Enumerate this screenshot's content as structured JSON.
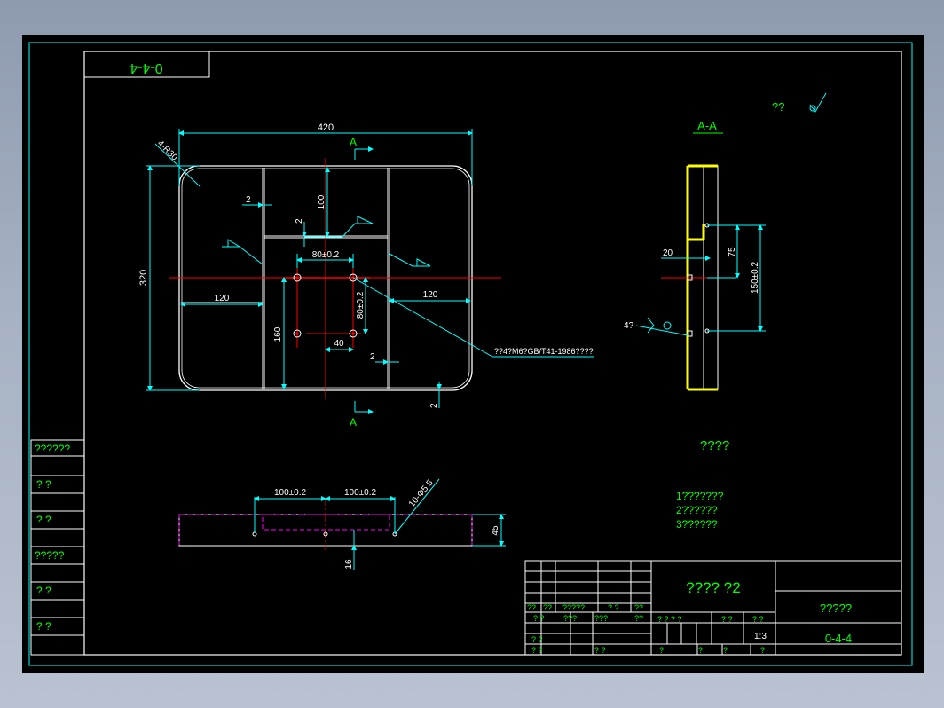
{
  "colors": {
    "frame": "#ffffff",
    "dimension": "#00ffff",
    "text": "#00ff00",
    "centerline": "#ff0000",
    "section": "#ffff00",
    "hidden": "#ff00ff"
  },
  "title_stamp": "0-4-4",
  "roughness_symbol": "??",
  "section_label_top": "A",
  "section_label_bottom": "A",
  "section_title": "A-A",
  "plan_view": {
    "dim_width": "420",
    "dim_height": "320",
    "corner_radius": "4-R30",
    "dim_100": "100",
    "dim_2_left": "2",
    "dim_2_mid": "2",
    "dim_80_h": "80±0.2",
    "dim_80_v": "80±0.2",
    "dim_120_left": "120",
    "dim_120_right": "120",
    "dim_160": "160",
    "dim_40": "40",
    "dim_2_bottom": "2",
    "dim_2_corner": "2",
    "hole_note": "??4?M6?GB/T41-1986????"
  },
  "section_view": {
    "dim_20": "20",
    "dim_75": "75",
    "dim_150": "150±0.2",
    "weld_label": "4?"
  },
  "front_view": {
    "dim_100_left": "100±0.2",
    "dim_100_right": "100±0.2",
    "hole_callout": "10-Φ5.5",
    "dim_45": "45",
    "dim_16": "16"
  },
  "notes": {
    "heading": "????",
    "items": [
      "1???????",
      "2??????",
      "3??????"
    ]
  },
  "side_table": [
    "??????",
    "?   ?",
    "?   ?",
    "?????",
    "?   ?",
    "?   ?"
  ],
  "title_block": {
    "part_name": "????  ?2",
    "company": "?????",
    "drawing_no": "0-4-4",
    "scale": "1:3",
    "header_row": [
      "??",
      "??",
      "?????",
      "? ?",
      "??"
    ],
    "sub_row": [
      "? ?",
      "???",
      "???",
      "??"
    ],
    "mid_row": [
      "? ? ? ?",
      "? ?",
      "? ?"
    ],
    "left_rows": [
      "? ?",
      "? ?"
    ],
    "bottom_cells": [
      "? ?",
      "?",
      "?",
      "?",
      "?"
    ]
  }
}
